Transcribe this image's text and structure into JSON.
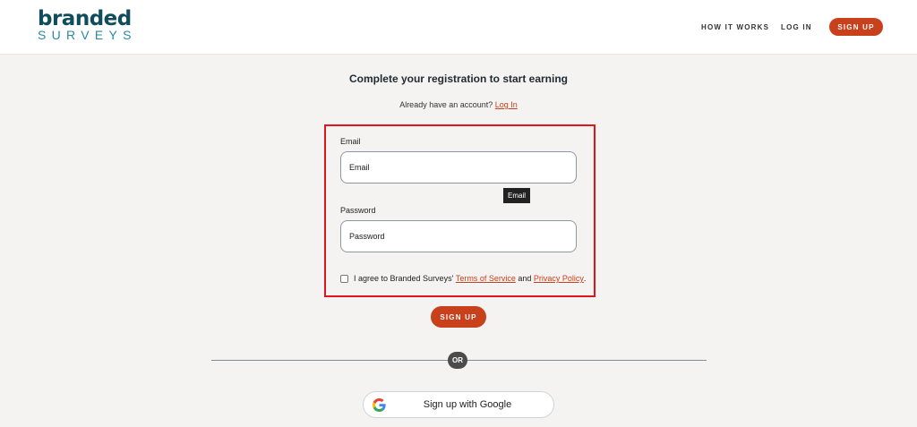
{
  "header": {
    "logo_top": "branded",
    "logo_bottom": "SURVEYS",
    "nav": {
      "how_it_works": "HOW IT WORKS",
      "log_in": "LOG IN",
      "sign_up": "SIGN UP"
    }
  },
  "main": {
    "title": "Complete your registration to start earning",
    "already_text": "Already have an account?",
    "login_link": "Log In",
    "email_label": "Email",
    "email_placeholder": "Email",
    "email_value": "",
    "tooltip": "Email",
    "password_label": "Password",
    "password_placeholder": "Password",
    "password_value": "",
    "agree_prefix": "I agree to Branded Surveys'",
    "terms": "Terms of Service",
    "and": "and",
    "privacy": "Privacy Policy",
    "period": ".",
    "agree_checked": false,
    "signup_button": "SIGN UP",
    "or": "OR",
    "google_button": "Sign up with Google"
  },
  "colors": {
    "accent": "#c8401c",
    "brand_dark": "#0f4d5c",
    "brand_light": "#2a8aa0",
    "highlight_box": "#e0161e"
  }
}
